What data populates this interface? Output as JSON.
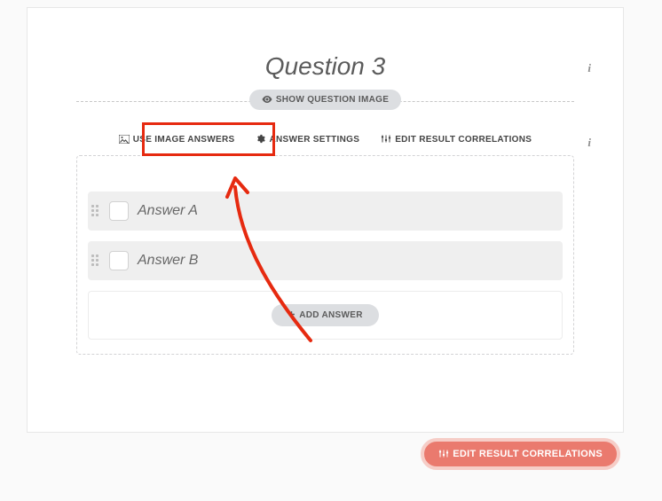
{
  "question": {
    "title": "Question 3"
  },
  "buttons": {
    "show_question_image": "SHOW QUESTION IMAGE",
    "add_answer": "ADD ANSWER"
  },
  "tabs": {
    "use_image_answers": "USE IMAGE ANSWERS",
    "answer_settings": "ANSWER SETTINGS",
    "edit_result_correlations": "EDIT RESULT CORRELATIONS"
  },
  "answers": [
    {
      "label": "Answer A"
    },
    {
      "label": "Answer B"
    }
  ],
  "floating": {
    "edit_result_correlations": "EDIT RESULT CORRELATIONS"
  },
  "info_glyph": "i"
}
